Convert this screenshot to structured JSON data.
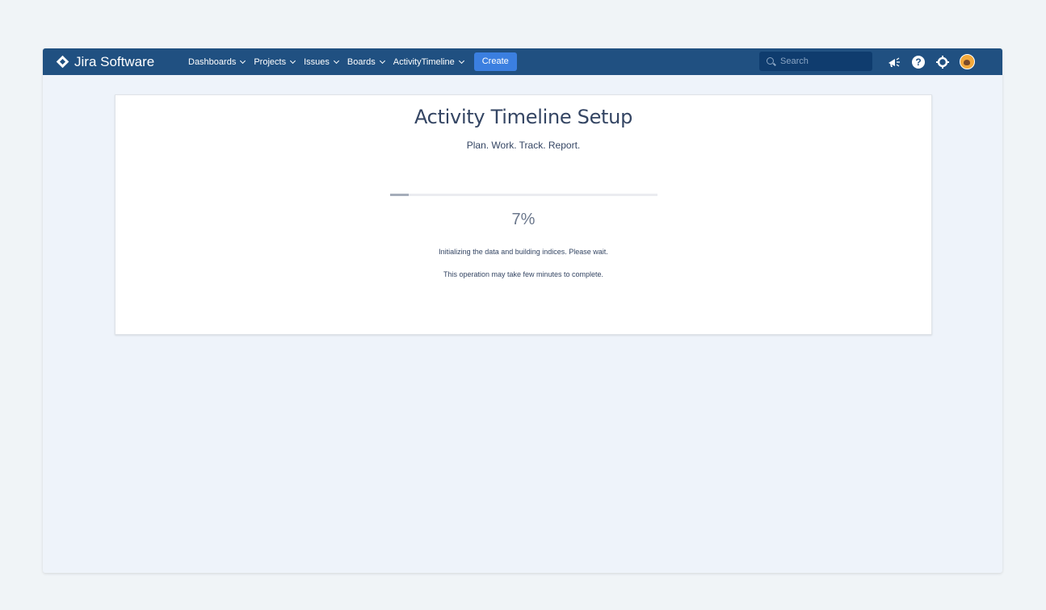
{
  "app": {
    "logo_text": "Jira Software"
  },
  "nav": {
    "items": [
      {
        "label": "Dashboards"
      },
      {
        "label": "Projects"
      },
      {
        "label": "Issues"
      },
      {
        "label": "Boards"
      },
      {
        "label": "ActivityTimeline"
      }
    ],
    "create_label": "Create"
  },
  "search": {
    "placeholder": "Search"
  },
  "header_icons": [
    "megaphone-icon",
    "help-icon",
    "gear-icon",
    "avatar"
  ],
  "setup": {
    "title": "Activity Timeline Setup",
    "subtitle": "Plan. Work. Track. Report.",
    "progress_value": 7,
    "progress_label": "7%",
    "message_1": "Initializing the data and building indices. Please wait.",
    "message_2": "This operation may take few minutes to complete."
  },
  "colors": {
    "topbar": "#205081",
    "create_button": "#3b7fe0",
    "page_background": "#eef3fa",
    "progress_fill": "#a5adba"
  }
}
